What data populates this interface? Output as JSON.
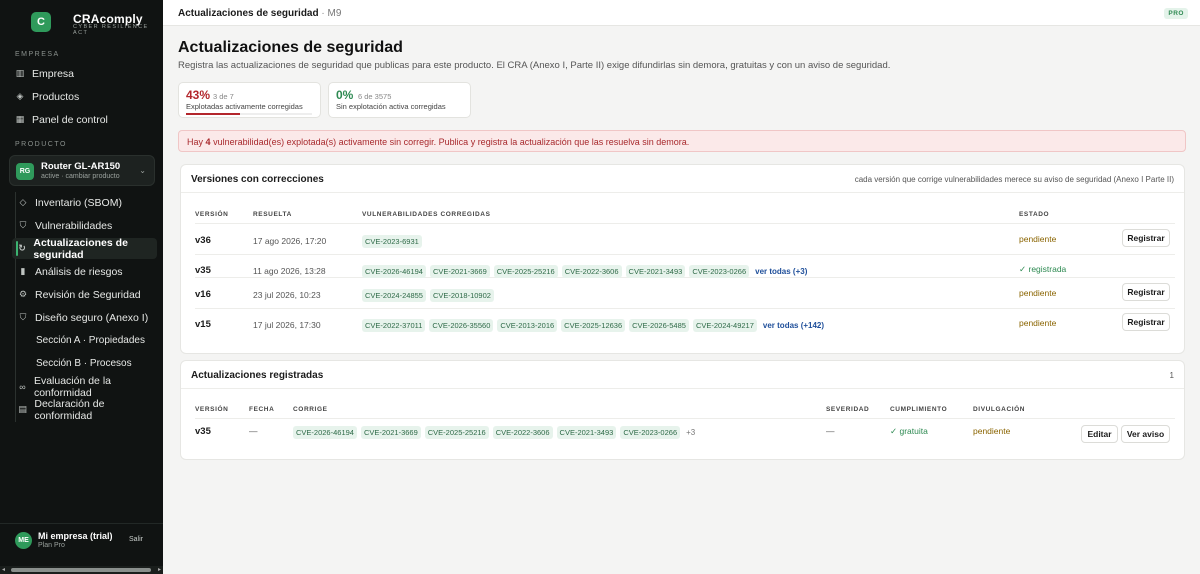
{
  "brand": {
    "logo_letter": "C",
    "name": "CRAcomply",
    "tagline": "CYBER RESILIENCE ACT"
  },
  "sidebar": {
    "section_company": "EMPRESA",
    "company_items": [
      {
        "label": "Empresa",
        "icon": "building-icon"
      },
      {
        "label": "Productos",
        "icon": "cube-icon"
      },
      {
        "label": "Panel de control",
        "icon": "grid-icon"
      }
    ],
    "section_product": "PRODUCTO",
    "product": {
      "badge": "RG",
      "name": "Router GL-AR150",
      "status": "active · cambiar producto"
    },
    "product_items": [
      {
        "label": "Inventario (SBOM)",
        "icon": "box-icon"
      },
      {
        "label": "Vulnerabilidades",
        "icon": "shield-icon"
      },
      {
        "label": "Actualizaciones de seguridad",
        "icon": "refresh-icon"
      },
      {
        "label": "Análisis de riesgos",
        "icon": "chart-icon"
      },
      {
        "label": "Revisión de Seguridad",
        "icon": "gear-icon"
      },
      {
        "label": "Diseño seguro (Anexo I)",
        "icon": "shield-check-icon"
      },
      {
        "label": "Sección A · Propiedades",
        "icon": ""
      },
      {
        "label": "Sección B · Procesos",
        "icon": ""
      },
      {
        "label": "Evaluación de la conformidad",
        "icon": "link-icon"
      },
      {
        "label": "Declaración de conformidad",
        "icon": "doc-icon"
      }
    ],
    "user": {
      "initials": "ME",
      "name": "Mi empresa (trial)",
      "plan": "Plan Pro",
      "logout": "Salir"
    }
  },
  "topbar": {
    "crumb": "Actualizaciones de seguridad",
    "sep": "·",
    "module": "M9",
    "badge": "PRO"
  },
  "page": {
    "title": "Actualizaciones de seguridad",
    "description": "Registra las actualizaciones de seguridad que publicas para este producto. El CRA (Anexo I, Parte II) exige difundirlas sin demora, gratuitas y con un aviso de seguridad."
  },
  "stats": [
    {
      "value": "43%",
      "detail": "3 de 7",
      "caption": "Explotadas activamente corregidas",
      "color": "#b3262c",
      "fraction": 0.43
    },
    {
      "value": "0%",
      "detail": "6 de 3575",
      "caption": "Sin explotación activa corregidas",
      "color": "#2e8a52",
      "fraction": 0.0
    }
  ],
  "alert": {
    "pre": "Hay",
    "count": "4",
    "post": "vulnerabilidad(es) explotada(s) activamente sin corregir. Publica y registra la actualización que las resuelva sin demora."
  },
  "versions": {
    "title": "Versiones con correcciones",
    "note": "cada versión que corrige vulnerabilidades merece su aviso de seguridad (Anexo I Parte II)",
    "headers": [
      "VERSIÓN",
      "RESUELTA",
      "VULNERABILIDADES CORREGIDAS",
      "ESTADO"
    ],
    "rows": [
      {
        "version": "v36",
        "date": "17 ago 2026, 17:20",
        "cves": [
          "CVE-2023-6931"
        ],
        "more": "",
        "state": "pendiente",
        "action": "Registrar"
      },
      {
        "version": "v35",
        "date": "11 ago 2026, 13:28",
        "cves": [
          "CVE-2026-46194",
          "CVE-2021-3669",
          "CVE-2025-25216",
          "CVE-2022-3606",
          "CVE-2021-3493",
          "CVE-2023-0266"
        ],
        "more": "ver todas (+3)",
        "state": "✓ registrada",
        "action": ""
      },
      {
        "version": "v16",
        "date": "23 jul 2026, 10:23",
        "cves": [
          "CVE-2024-24855",
          "CVE-2018-10902"
        ],
        "more": "",
        "state": "pendiente",
        "action": "Registrar"
      },
      {
        "version": "v15",
        "date": "17 jul 2026, 17:30",
        "cves": [
          "CVE-2022-37011",
          "CVE-2026-35560",
          "CVE-2013-2016",
          "CVE-2025-12636",
          "CVE-2026-5485",
          "CVE-2024-49217"
        ],
        "more": "ver todas (+142)",
        "state": "pendiente",
        "action": "Registrar"
      }
    ]
  },
  "registered": {
    "title": "Actualizaciones registradas",
    "count": "1",
    "headers": [
      "VERSIÓN",
      "FECHA",
      "CORRIGE",
      "SEVERIDAD",
      "CUMPLIMIENTO",
      "DIVULGACIÓN"
    ],
    "rows": [
      {
        "version": "v35",
        "date": "—",
        "cves": [
          "CVE-2026-46194",
          "CVE-2021-3669",
          "CVE-2025-25216",
          "CVE-2022-3606",
          "CVE-2021-3493",
          "CVE-2023-0266"
        ],
        "more": "+3",
        "severity": "—",
        "compliance": "✓ gratuita",
        "disclosure": "pendiente",
        "edit": "Editar",
        "view": "Ver aviso"
      }
    ]
  }
}
